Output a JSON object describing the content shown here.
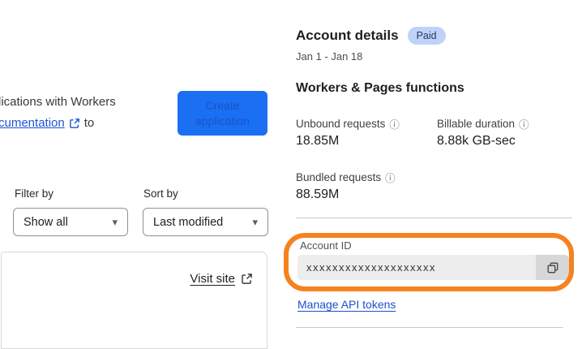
{
  "left_panel": {
    "intro_line1": "lications with Workers",
    "intro_link_text": "cumentation",
    "intro_after_link": "to",
    "create_button_label": "Create application",
    "filter": {
      "label": "Filter by",
      "value": "Show all"
    },
    "sort": {
      "label": "Sort by",
      "value": "Last modified"
    },
    "visit_site_label": "Visit site"
  },
  "account_panel": {
    "title": "Account details",
    "plan_badge": "Paid",
    "date_range": "Jan 1 - Jan 18",
    "section_title": "Workers & Pages functions",
    "metrics": [
      {
        "label": "Unbound requests",
        "value": "18.85M"
      },
      {
        "label": "Billable duration",
        "value": "8.88k GB-sec"
      },
      {
        "label": "Bundled requests",
        "value": "88.59M"
      }
    ],
    "account_id": {
      "label": "Account ID",
      "value": "xxxxxxxxxxxxxxxxxxxx"
    },
    "manage_api_tokens_label": "Manage API tokens"
  },
  "icons": {
    "info": "ⓘ",
    "caret": "▾"
  },
  "colors": {
    "primary_button_bg": "#1a6ff3",
    "badge_bg": "#bfd3f8",
    "badge_text": "#21386b",
    "link_blue": "#1d50cb",
    "highlight_orange": "#f6821f"
  }
}
